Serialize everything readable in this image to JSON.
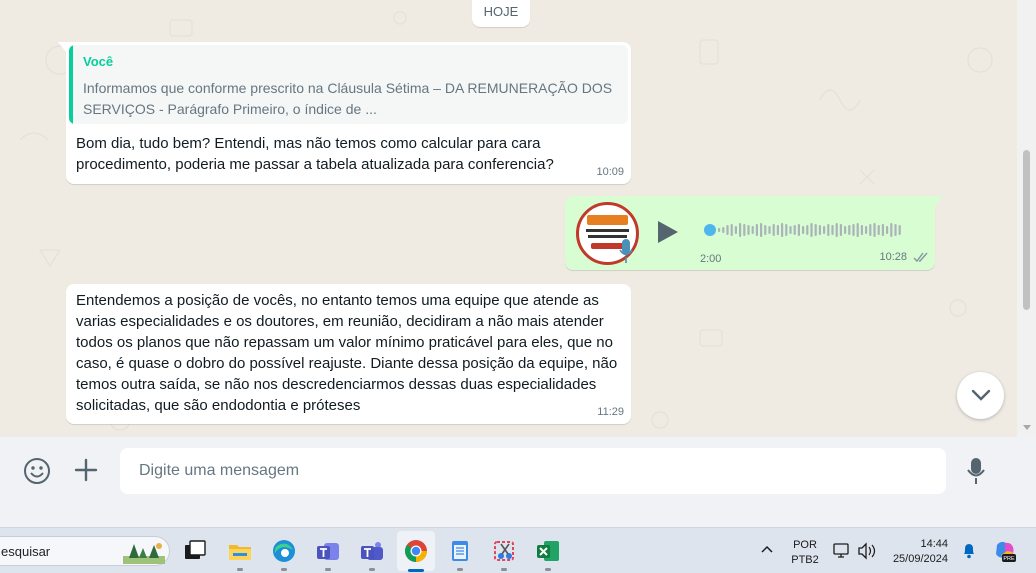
{
  "chat": {
    "date_chip": "HOJE",
    "messages": [
      {
        "quote_author": "Você",
        "quote_text": "Informamos que conforme prescrito na Cláusula Sétima – DA REMUNERAÇÃO DOS SERVIÇOS - Parágrafo Primeiro, o índice de ...",
        "text": "Bom dia, tudo bem? Entendi, mas não temos como calcular para cara procedimento, poderia me passar a tabela atualizada para conferencia?",
        "time": "10:09"
      },
      {
        "type": "voice",
        "duration": "2:00",
        "time": "10:28",
        "status": "delivered-double-check"
      },
      {
        "text": "Entendemos a posição de vocês, no entanto temos uma equipe que atende as varias especialidades e os doutores, em reunião, decidiram a não mais atender todos os planos que não repassam um valor mínimo praticável para eles, que no caso, é quase o dobro do possível reajuste. Diante dessa posição da equipe, não temos outra saída, se não nos descredenciarmos dessas duas especialidades solicitadas, que são endodontia e próteses",
        "time": "11:29"
      }
    ]
  },
  "composer": {
    "placeholder": "Digite uma mensagem",
    "icons": [
      "emoji-icon",
      "plus-icon",
      "microphone-icon"
    ]
  },
  "taskbar": {
    "search_text": "esquisar",
    "apps": [
      "task-view",
      "file-explorer",
      "edge",
      "teams-work",
      "teams",
      "chrome",
      "notepad",
      "snipping-tool",
      "excel"
    ],
    "active_app": "chrome",
    "language": "POR",
    "keyboard": "PTB2",
    "time": "14:44",
    "date": "25/09/2024",
    "copilot_badge": "PRE"
  },
  "colors": {
    "chat_bg": "#efeae2",
    "outgoing_bubble": "#d9fdd3",
    "quote_accent": "#06cf9c",
    "taskbar_bg": "#dee4ee"
  }
}
